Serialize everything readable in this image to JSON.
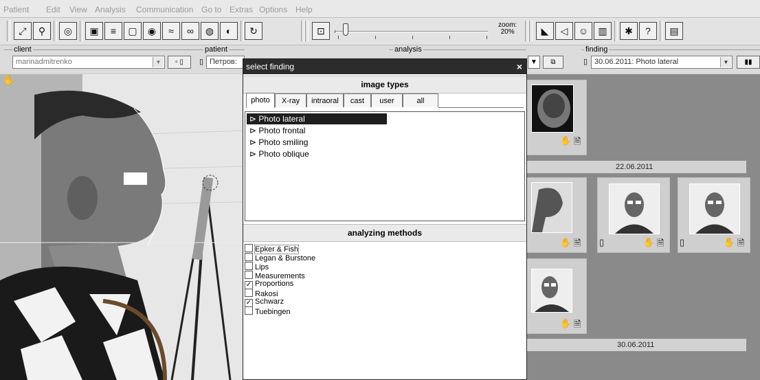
{
  "menu": [
    "Patient",
    "Edit",
    "View",
    "Analysis",
    "Communication",
    "Go to",
    "Extras",
    "Options",
    "Help"
  ],
  "toolbar": {
    "zoom_label": "zoom:",
    "zoom_value": "20%",
    "zoom_level": 0.05
  },
  "selectors": {
    "client_label": "client",
    "client_value": "marinadmitrenko",
    "patient_label": "patient",
    "patient_value": "Петров:",
    "analysis_label": "analysis",
    "finding_label": "finding",
    "finding_value": "30.06.2011: Photo lateral"
  },
  "dialog": {
    "title": "select finding",
    "close": "×",
    "image_types_heading": "image types",
    "tabs": [
      "photo",
      "X-ray",
      "intraoral",
      "cast",
      "user",
      "all"
    ],
    "active_tab": "photo",
    "image_types": [
      "Photo lateral",
      "Photo frontal",
      "Photo smiling",
      "Photo oblique"
    ],
    "selected_image_type": "Photo lateral",
    "analyzing_heading": "analyzing methods",
    "methods": [
      {
        "label": "Epker & Fish",
        "checked": false
      },
      {
        "label": "Legan & Burstone",
        "checked": false
      },
      {
        "label": "Lips",
        "checked": false
      },
      {
        "label": "Measurements",
        "checked": false
      },
      {
        "label": "Proportions",
        "checked": true
      },
      {
        "label": "Rakosi",
        "checked": false
      },
      {
        "label": "Schwarz",
        "checked": true
      },
      {
        "label": "Tuebingen",
        "checked": false
      }
    ]
  },
  "thumbnails": {
    "date1": "22.06.2011",
    "date2": "30.06.2011"
  },
  "icons": [
    "hand-icon",
    "document-icon",
    "close-icon",
    "chevron-down-icon",
    "checkbox-icon"
  ]
}
